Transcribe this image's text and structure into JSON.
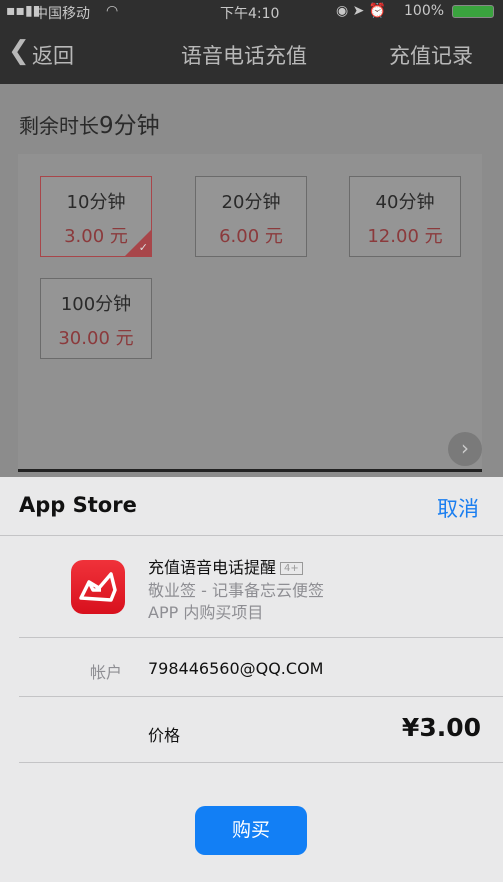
{
  "status": {
    "carrier": "中国移动",
    "time": "下午4:10",
    "battery": "100%"
  },
  "nav": {
    "back": "返回",
    "title": "语音电话充值",
    "right": "充值记录"
  },
  "remaining": {
    "label": "剩余时长",
    "value": "9分钟"
  },
  "options": [
    {
      "minutes": "10分钟",
      "price": "3.00 元",
      "selected": true
    },
    {
      "minutes": "20分钟",
      "price": "6.00 元",
      "selected": false
    },
    {
      "minutes": "40分钟",
      "price": "12.00 元",
      "selected": false
    },
    {
      "minutes": "100分钟",
      "price": "30.00 元",
      "selected": false
    }
  ],
  "sheet": {
    "title": "App Store",
    "cancel": "取消",
    "product": "充值语音电话提醒",
    "age": "4+",
    "app": "敬业签 - 记事备忘云便签",
    "type": "APP 内购买项目",
    "account_label": "帐户",
    "account": "798446560@QQ.COM",
    "price_label": "价格",
    "price": "¥3.00",
    "buy": "购买"
  },
  "colors": {
    "accent": "#127ff5",
    "selected": "#a8464a"
  }
}
